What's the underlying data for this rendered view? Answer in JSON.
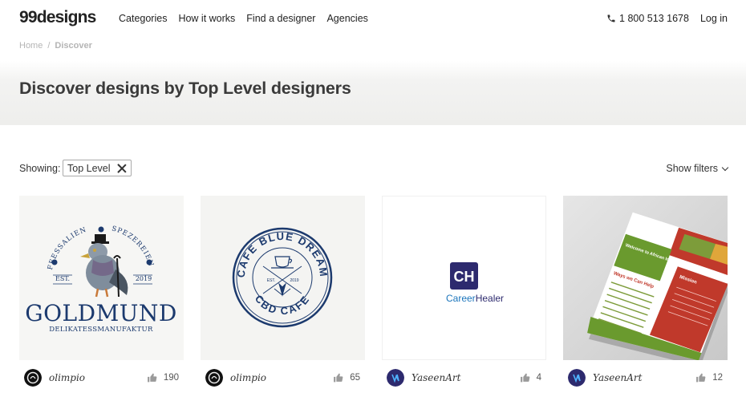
{
  "header": {
    "logo": "99designs",
    "nav": [
      "Categories",
      "How it works",
      "Find a designer",
      "Agencies"
    ],
    "phone": "1 800 513 1678",
    "login": "Log in"
  },
  "breadcrumb": {
    "home": "Home",
    "separator": "/",
    "current": "Discover"
  },
  "hero": {
    "title": "Discover designs by Top Level designers"
  },
  "filters": {
    "showing_label": "Showing:",
    "chip": "Top Level",
    "show_filters": "Show filters"
  },
  "cards": [
    {
      "designer": "olimpio",
      "likes": "190",
      "art": {
        "line1": "GOLDMUND",
        "line2": "DELIKATESSMANUFAKTUR",
        "arc_left": "FEESSALIEN",
        "arc_right": "SPEZEREIEN",
        "est": "EST.",
        "year": "2019"
      }
    },
    {
      "designer": "olimpio",
      "likes": "65",
      "art": {
        "top": "CAFE BLUE DREAM",
        "bottom": "CBD CAFE",
        "est": "EST.",
        "year": "2019"
      }
    },
    {
      "designer": "YaseenArt",
      "likes": "4",
      "art": {
        "monogram": "CH",
        "name_a": "Career",
        "name_b": "Healer"
      }
    },
    {
      "designer": "YaseenArt",
      "likes": "12",
      "art": {
        "heading": "Welcome to African Immigrant Community Services",
        "ways": "Ways we Can Help",
        "mission": "Mission"
      }
    }
  ],
  "colors": {
    "accent_blue": "#1c3a6e",
    "ch_purple": "#2d2a6e",
    "ch_blue": "#1b75bc"
  }
}
